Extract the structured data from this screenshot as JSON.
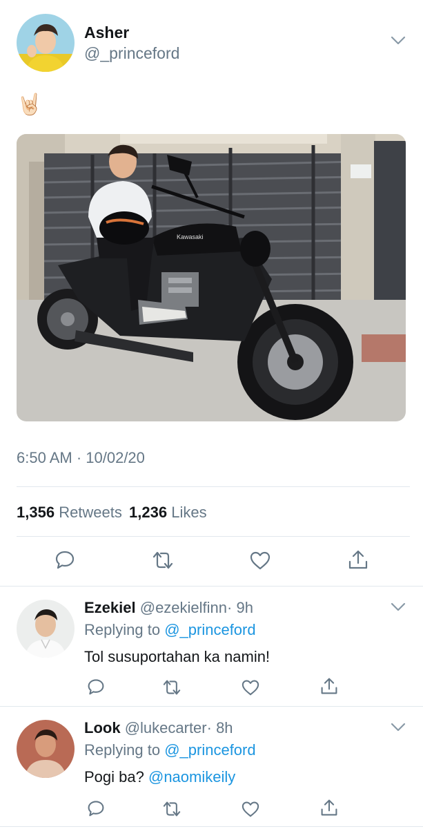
{
  "tweet": {
    "author_name": "Asher",
    "author_handle": "@_princeford",
    "emoji": "🤘🏻",
    "timestamp": "6:50 AM · 10/02/20",
    "retweet_count": "1,356",
    "retweet_label": "Retweets",
    "like_count": "1,236",
    "like_label": "Likes"
  },
  "replies": [
    {
      "name": "Ezekiel",
      "handle": "@ezekielfinn",
      "age": "· 9h",
      "replying_prefix": "Replying to",
      "replying_to": "@_princeford",
      "text": "Tol susuportahan ka namin!"
    },
    {
      "name": "Look",
      "handle": "@lukecarter",
      "age": "· 8h",
      "replying_prefix": "Replying to",
      "replying_to": "@_princeford",
      "text": "Pogi ba?",
      "mention": "@naomikeily"
    }
  ],
  "photo": {
    "bike_brand": "Kawasaki"
  },
  "colors": {
    "link": "#1b95e0",
    "muted": "#657786",
    "icon": "#657786",
    "divider": "#e1e8ed"
  }
}
